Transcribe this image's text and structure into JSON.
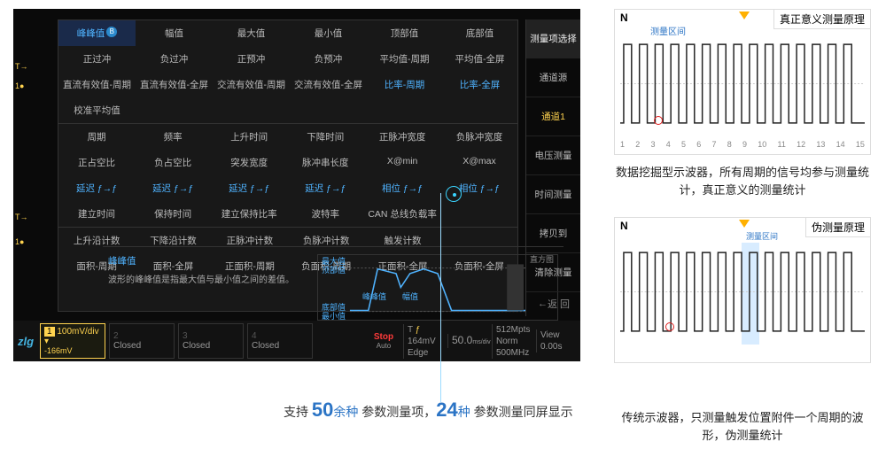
{
  "scope": {
    "menu": {
      "header": [
        "峰峰值",
        "幅值",
        "最大值",
        "最小值",
        "顶部值",
        "底部值"
      ],
      "r2": [
        "正过冲",
        "负过冲",
        "正预冲",
        "负预冲",
        "平均值-周期",
        "平均值-全屏"
      ],
      "r3": [
        "直流有效值-周期",
        "直流有效值-全屏",
        "交流有效值-周期",
        "交流有效值-全屏",
        "比率-周期",
        "比率-全屏"
      ],
      "r4": [
        "校准平均值",
        "",
        "",
        "",
        "",
        ""
      ],
      "r5": [
        "周期",
        "频率",
        "上升时间",
        "下降时间",
        "正脉冲宽度",
        "负脉冲宽度"
      ],
      "r6": [
        "正占空比",
        "负占空比",
        "突发宽度",
        "脉冲串长度",
        "X@min",
        "X@max"
      ],
      "r7": [
        "延迟 ƒ→ƒ",
        "延迟 ƒ→ƒ",
        "延迟 ƒ→ƒ",
        "延迟 ƒ→ƒ",
        "相位 ƒ→ƒ",
        "相位 ƒ→ƒ"
      ],
      "r8": [
        "建立时间",
        "保持时间",
        "建立保持比率",
        "波特率",
        "CAN 总线负载率",
        ""
      ],
      "r9": [
        "上升沿计数",
        "下降沿计数",
        "正脉冲计数",
        "负脉冲计数",
        "触发计数",
        ""
      ],
      "r10": [
        "面积-周期",
        "面积-全屏",
        "正面积-周期",
        "负面积-周期",
        "正面积-全屏",
        "负面积-全屏"
      ]
    },
    "desc": {
      "title": "峰峰值",
      "body": "波形的峰峰值是指最大值与最小值之间的差值。",
      "wave_labels": {
        "max": "最大值",
        "top": "顶部值",
        "pp": "峰峰值",
        "amp": "幅值",
        "bot": "底部值",
        "min": "最小值",
        "hist": "直方图"
      }
    },
    "right_menu": [
      "测量项选择",
      "通道源",
      "通道1",
      "电压测量",
      "时间测量",
      "拷贝到",
      "清除测量"
    ],
    "back": "返 回",
    "side_marks": {
      "T1": "T→",
      "one": "1●",
      "T2": "T→",
      "one2": "1●"
    },
    "bottom": {
      "logo": "zlg",
      "ch1": {
        "num": "1",
        "scale": "100mV/div",
        "offset": "-166mV"
      },
      "ch_closed": "Closed",
      "ch_nums": [
        "2",
        "3",
        "4"
      ],
      "stop": "Stop",
      "trig_mode": "Auto",
      "trig_t": "T",
      "trig_level": "164mV",
      "trig_edge": "Edge",
      "time": "50.0",
      "time_unit": "ms/div",
      "acq": "512Mpts",
      "acq_norm": "Norm",
      "acq_rate": "500MHz",
      "view": "View",
      "view_val": "0.00s"
    },
    "can_bus_highlight": "CAN 总线负载率"
  },
  "caption": {
    "pre": "支持 ",
    "n1": "50",
    "mid": "余种",
    "m1": "参数测量项，",
    "n2": "24",
    "m2": "种",
    "post": "参数测量同屏显示"
  },
  "diag1": {
    "title": "真正意义测量原理",
    "N": "N",
    "region": "测量区间",
    "ticks": [
      "1",
      "2",
      "3",
      "4",
      "5",
      "6",
      "7",
      "8",
      "9",
      "10",
      "11",
      "12",
      "13",
      "14",
      "15"
    ],
    "caption": "数据挖掘型示波器，所有周期的信号均参与测量统计，真正意义的测量统计"
  },
  "diag2": {
    "title": "伪测量原理",
    "N": "N",
    "region": "测量区间",
    "caption": "传统示波器，只测量触发位置附件一个周期的波形，伪测量统计"
  }
}
